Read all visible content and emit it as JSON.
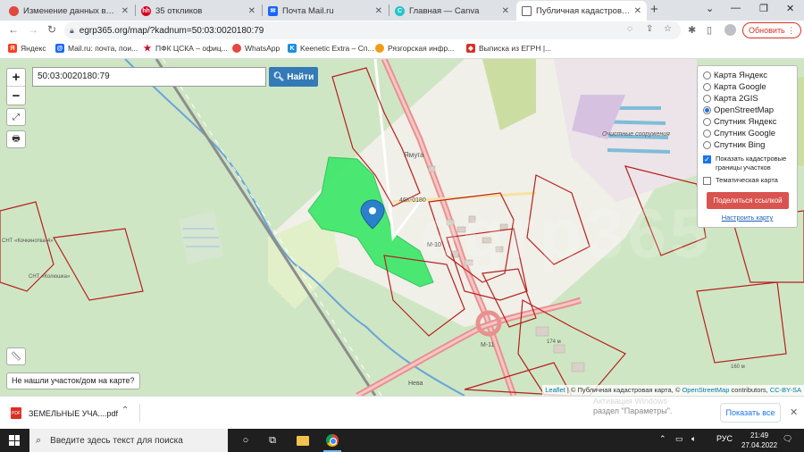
{
  "tabs": [
    {
      "title": "Изменение данных владел...",
      "icon": "opera-icon",
      "color": "#e0493f"
    },
    {
      "title": "35 откликов",
      "icon": "hh-icon",
      "color": "#d6001c"
    },
    {
      "title": "Почта Mail.ru",
      "icon": "mail-icon",
      "color": "#1966ff"
    },
    {
      "title": "Главная — Canva",
      "icon": "canva-icon",
      "color": "#20c4cb"
    },
    {
      "title": "Публичная кадастровая ка...",
      "icon": "page-icon",
      "color": "#5f6368"
    }
  ],
  "toolbar": {
    "url": "egrp365.org/map/?kadnum=50:03:0020180:79",
    "update_label": "Обновить"
  },
  "bookmarks": [
    {
      "label": "Яндекс",
      "color": "#fc3f1d",
      "glyph": "Я"
    },
    {
      "label": "Mail.ru: почта, пои...",
      "color": "#1966ff",
      "glyph": "@"
    },
    {
      "label": "ПФК ЦСКА – офиц...",
      "color": "#c8102e",
      "glyph": "★"
    },
    {
      "label": "WhatsApp",
      "color": "#e8453c",
      "glyph": "●"
    },
    {
      "label": "Keenetic Extra – Сп...",
      "color": "#1d8fe1",
      "glyph": "K"
    },
    {
      "label": "Рязгорская инфр...",
      "color": "#f39c12",
      "glyph": "●"
    },
    {
      "label": "Выписка из ЕГРН |...",
      "color": "#d93025",
      "glyph": "◆"
    }
  ],
  "map": {
    "search_value": "50:03:0020180:79",
    "search_button": "Найти",
    "zoom_in": "+",
    "zoom_out": "−",
    "layers": [
      "Карта Яндекс",
      "Карта Google",
      "Карта 2GIS",
      "OpenStreetMap",
      "Спутник Яндекс",
      "Спутник Google",
      "Спутник Bing"
    ],
    "selected_layer": "OpenStreetMap",
    "show_boundaries": "Показать кадастровые границы участков",
    "thematic": "Тематическая карта",
    "share": "Поделиться ссылкой",
    "configure": "Настроить карту",
    "not_found": "Не нашли участок/дом на карте?",
    "labels": {
      "village": "Ямуга",
      "road1": "46К-0180",
      "road2": "М-10",
      "road3": "М-11",
      "road4": "Нева",
      "plant": "Очистные сооружения",
      "snt1": "СНТ «Кочкинотва-4»",
      "snt2": "СНТ «Колюшка»",
      "elev1": "174 м",
      "elev2": "160 м"
    },
    "attribution": {
      "leaflet": "Leaflet",
      "rest": " | © Публичная кадастровая карта, © ",
      "osm": "OpenStreetMap",
      "contrib": " contributors, ",
      "cc": "CC-BY-SA"
    },
    "watermark": "egrp365"
  },
  "download": {
    "filename": "ЗЕМЕЛЬНЫЕ УЧА....pdf",
    "activate_line1": "Активация Windows",
    "activate_line2": "раздел \"Параметры\".",
    "show_all": "Показать все"
  },
  "taskbar": {
    "search_placeholder": "Введите здесь текст для поиска",
    "lang": "РУС",
    "time": "21:49",
    "date": "27.04.2022"
  }
}
